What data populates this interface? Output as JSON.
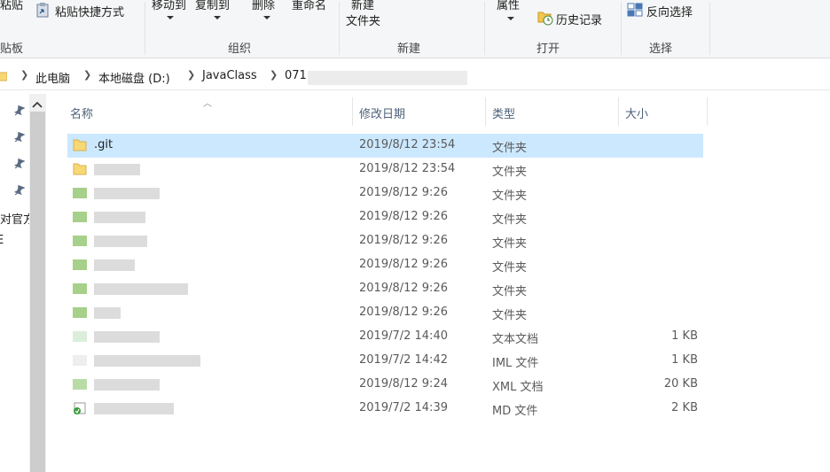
{
  "ribbon": {
    "clipboard": {
      "paste_label": "粘贴",
      "paste_shortcut_label": "粘贴快捷方式",
      "group_label": "剪贴板"
    },
    "organize": {
      "move_to_label": "移动到",
      "copy_to_label": "复制到",
      "delete_label": "删除",
      "rename_label": "重命名",
      "group_label": "组织"
    },
    "new": {
      "new_label": "新建",
      "new_folder_label": "文件夹",
      "group_label": "新建"
    },
    "open": {
      "properties_label": "属性",
      "history_label": "历史记录",
      "group_label": "打开"
    },
    "select": {
      "invert_label": "反向选择",
      "group_label": "选择"
    }
  },
  "address": {
    "crumbs": [
      "此电脑",
      "本地磁盘 (D:)",
      "JavaClass",
      "071"
    ]
  },
  "nav": {
    "truncated_items": [
      "对官方",
      "E"
    ]
  },
  "columns": {
    "name": "名称",
    "date": "修改日期",
    "type": "类型",
    "size": "大小"
  },
  "files": [
    {
      "name": ".git",
      "date": "2019/8/12 23:54",
      "type": "文件夹",
      "size": "",
      "icon": "folder-icon",
      "selected": true
    },
    {
      "name": "",
      "date": "2019/8/12 23:54",
      "type": "文件夹",
      "size": "",
      "icon": "folder-icon"
    },
    {
      "name": "",
      "date": "2019/8/12 9:26",
      "type": "文件夹",
      "size": "",
      "icon": "folder-icon"
    },
    {
      "name": "",
      "date": "2019/8/12 9:26",
      "type": "文件夹",
      "size": "",
      "icon": "folder-icon"
    },
    {
      "name": "",
      "date": "2019/8/12 9:26",
      "type": "文件夹",
      "size": "",
      "icon": "folder-icon"
    },
    {
      "name": "",
      "date": "2019/8/12 9:26",
      "type": "文件夹",
      "size": "",
      "icon": "folder-icon"
    },
    {
      "name": "",
      "date": "2019/8/12 9:26",
      "type": "文件夹",
      "size": "",
      "icon": "folder-icon"
    },
    {
      "name": "",
      "date": "2019/8/12 9:26",
      "type": "文件夹",
      "size": "",
      "icon": "folder-icon"
    },
    {
      "name": "",
      "date": "2019/7/2 14:40",
      "type": "文本文档",
      "size": "1 KB",
      "icon": "text-file-icon"
    },
    {
      "name": "",
      "date": "2019/7/2 14:42",
      "type": "IML 文件",
      "size": "1 KB",
      "icon": "file-icon"
    },
    {
      "name": "",
      "date": "2019/8/12 9:24",
      "type": "XML 文档",
      "size": "20 KB",
      "icon": "xml-file-icon"
    },
    {
      "name": "",
      "date": "2019/7/2 14:39",
      "type": "MD 文件",
      "size": "2 KB",
      "icon": "md-file-icon"
    }
  ],
  "colors": {
    "selected_row": "#cce8ff",
    "folder": "#f8d775",
    "header_text": "#4c607a",
    "ribbon_bg": "#f5f6f7"
  }
}
